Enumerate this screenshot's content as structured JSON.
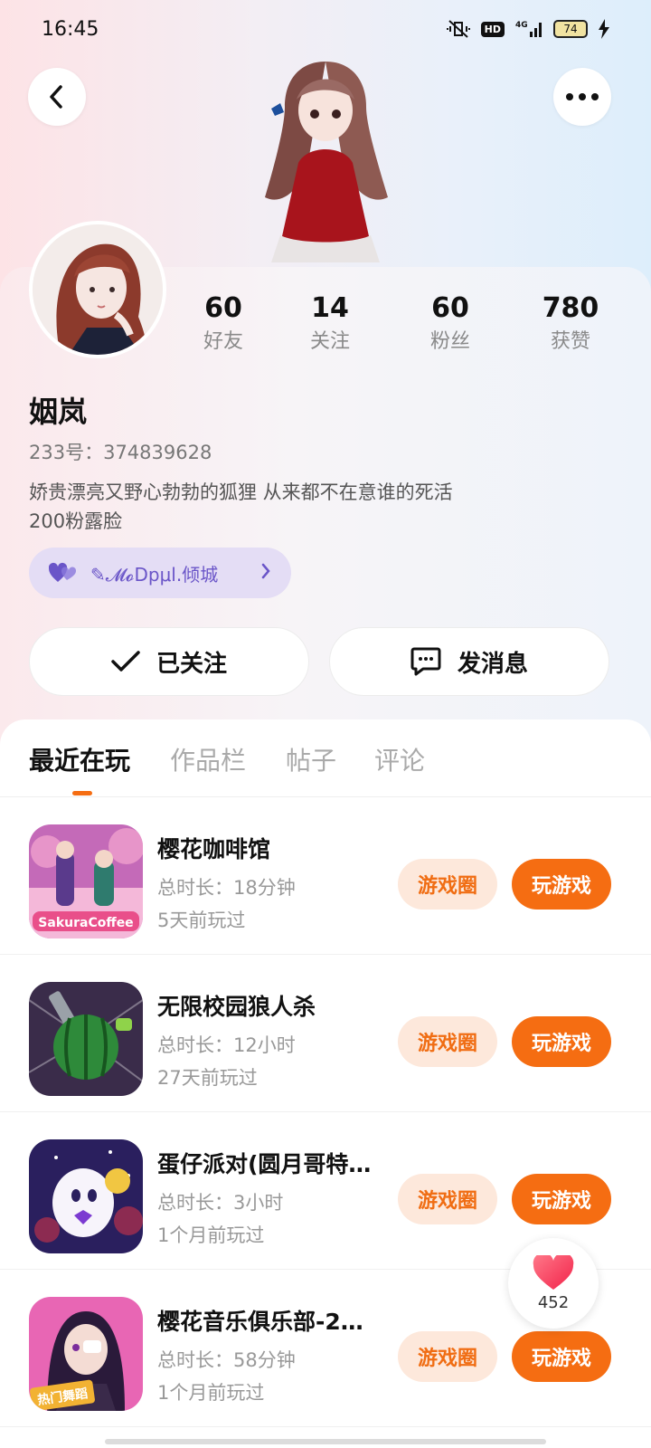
{
  "status_bar": {
    "time": "16:45",
    "battery": "74",
    "network": "4G",
    "hd_label": "HD"
  },
  "profile": {
    "name": "姻岚",
    "id_label": "233号：374839628",
    "bio_line1": "娇贵漂亮又野心勃勃的狐狸 从来都不在意谁的死活",
    "bio_line2": "200粉露脸",
    "guild": "✎𝓜𝓸Dpμl.倾城",
    "stats": [
      {
        "value": "60",
        "label": "好友"
      },
      {
        "value": "14",
        "label": "关注"
      },
      {
        "value": "60",
        "label": "粉丝"
      },
      {
        "value": "780",
        "label": "获赞"
      }
    ]
  },
  "actions": {
    "follow_label": "已关注",
    "message_label": "发消息"
  },
  "tabs": [
    "最近在玩",
    "作品栏",
    "帖子",
    "评论"
  ],
  "games": [
    {
      "title": "樱花咖啡馆",
      "duration": "总时长：18分钟",
      "last_played": "5天前玩过",
      "icon": "sakura-coffee-icon"
    },
    {
      "title": "无限校园狼人杀",
      "duration": "总时长：12小时",
      "last_played": "27天前玩过",
      "icon": "watermelon-icon"
    },
    {
      "title": "蛋仔派对(圆月哥特…",
      "duration": "总时长：3小时",
      "last_played": "1个月前玩过",
      "icon": "eggy-party-icon"
    },
    {
      "title": "樱花音乐俱乐部-2…",
      "duration": "总时长：58分钟",
      "last_played": "1个月前玩过",
      "icon": "music-club-icon"
    }
  ],
  "game_buttons": {
    "circle_label": "游戏圈",
    "play_label": "玩游戏"
  },
  "sakura_logo_text": "SakuraCoffee",
  "hot_dance_badge": "热门舞蹈",
  "likes": {
    "count": "452"
  },
  "colors": {
    "accent": "#f56d12",
    "accent_light": "#fde8db",
    "guild_purple": "#6a55c8"
  }
}
